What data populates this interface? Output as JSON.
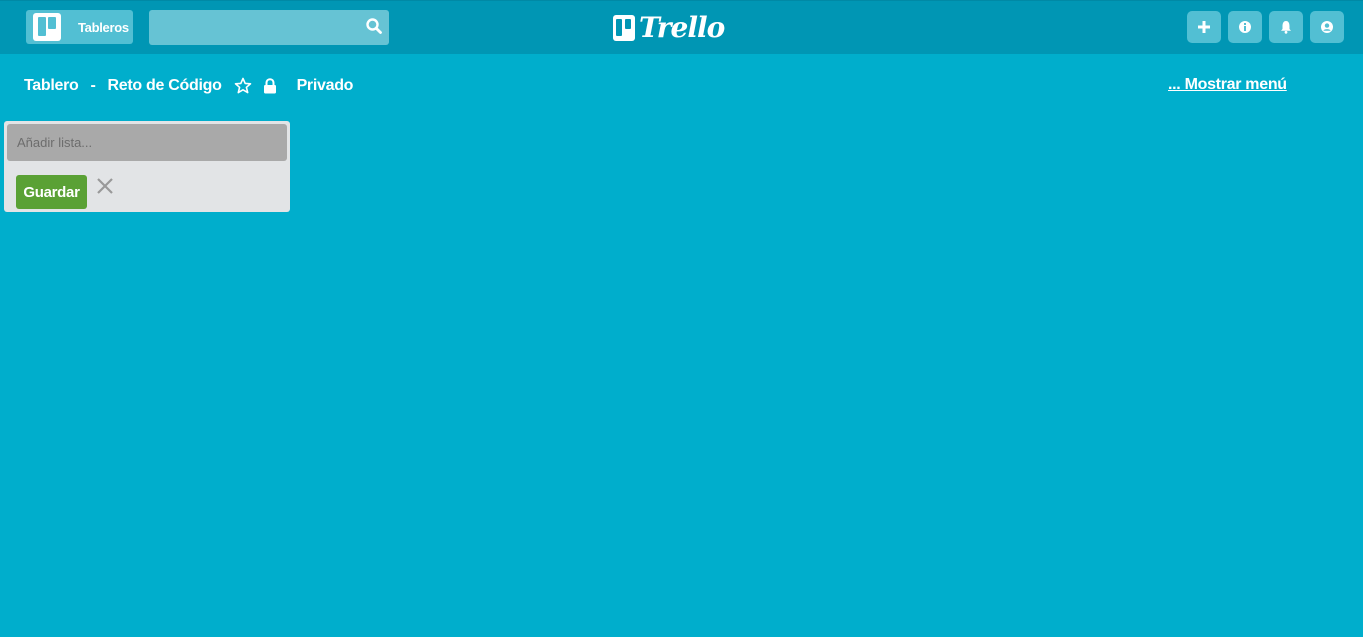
{
  "topbar": {
    "boards_label": "Tableros",
    "search": {
      "value": "",
      "placeholder": ""
    },
    "brand": "Trello",
    "actions": [
      {
        "icon": "plus-icon"
      },
      {
        "icon": "info-icon"
      },
      {
        "icon": "bell-icon"
      },
      {
        "icon": "user-icon"
      }
    ]
  },
  "board": {
    "prefix": "Tablero",
    "separator": "-",
    "name": "Reto de Código",
    "privacy": "Privado",
    "show_menu": "... Mostrar menú"
  },
  "add_list": {
    "placeholder": "Añadir lista...",
    "save_label": "Guardar"
  },
  "colors": {
    "background": "#00aecc",
    "topbar": "#0096b4",
    "save_button": "#5aa135"
  }
}
